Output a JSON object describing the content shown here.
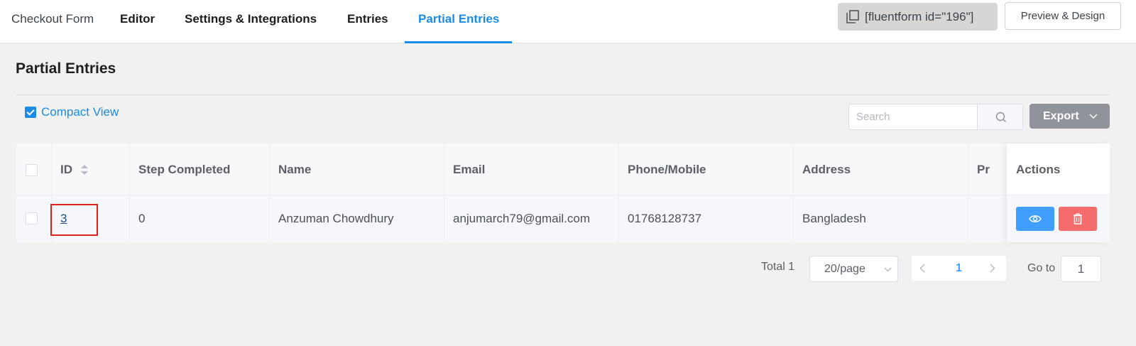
{
  "nav": {
    "form_name": "Checkout Form",
    "tabs": [
      {
        "label": "Editor"
      },
      {
        "label": "Settings & Integrations"
      },
      {
        "label": "Entries"
      },
      {
        "label": "Partial Entries"
      }
    ],
    "active_tab": "Partial Entries",
    "shortcode": "[fluentform id=\"196\"]",
    "preview_label": "Preview & Design"
  },
  "page": {
    "title": "Partial Entries",
    "compact_view_label": "Compact View",
    "compact_view_checked": true
  },
  "toolbar": {
    "search_placeholder": "Search",
    "export_label": "Export"
  },
  "table": {
    "columns": [
      "ID",
      "Step Completed",
      "Name",
      "Email",
      "Phone/Mobile",
      "Address",
      "Pr",
      "Actions"
    ],
    "rows": [
      {
        "id": "3",
        "step_completed": "0",
        "name": "Anzuman Chowdhury",
        "email": "anjumarch79@gmail.com",
        "phone": "01768128737",
        "address": "Bangladesh"
      }
    ]
  },
  "pagination": {
    "total_label": "Total 1",
    "page_size": "20/page",
    "current_page": "1",
    "goto_label": "Go to",
    "goto_value": "1"
  },
  "colors": {
    "accent": "#1a8ce6",
    "view_button": "#409eff",
    "delete_button": "#f56c6c",
    "export_button": "#909399",
    "highlight_box": "#e0201b"
  }
}
